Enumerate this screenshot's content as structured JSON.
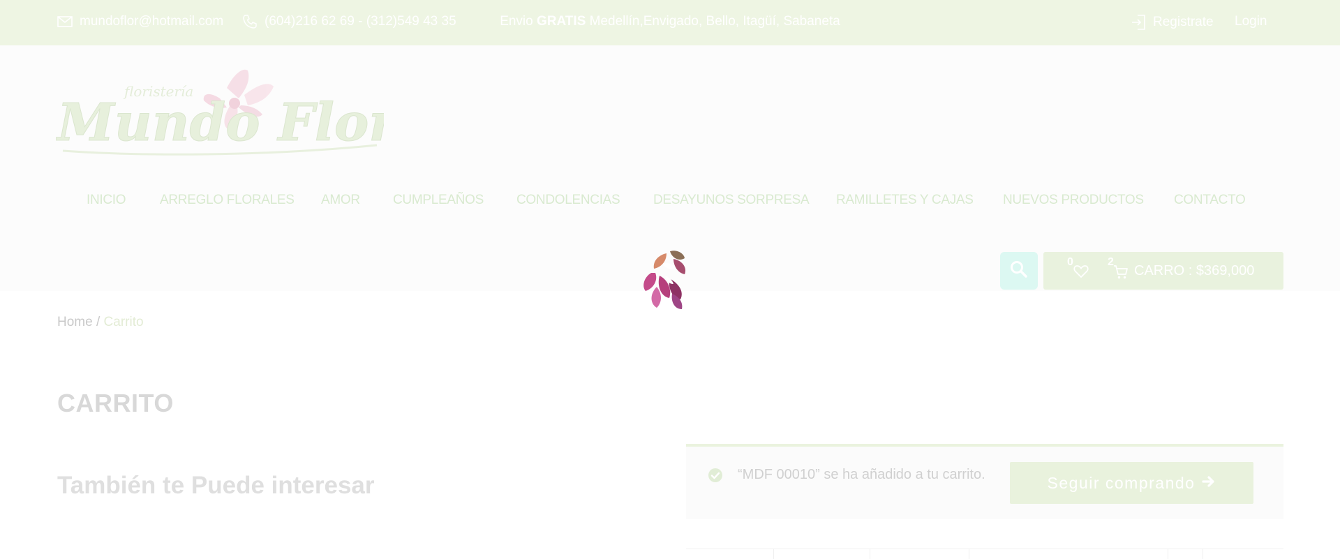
{
  "topbar": {
    "email": "mundoflor@hotmail.com",
    "phone": "(604)216 62 69 - (312)549 43 35",
    "promo_prefix": "Envio",
    "promo_bold": "GRATIS",
    "promo_suffix": "Medellín,Envigado, Bello, Itagüí, Sabaneta",
    "register_label": "Registrate",
    "login_label": "Login"
  },
  "logo": {
    "brand_top": "floristería",
    "brand_main": "Mundo Flor"
  },
  "nav": {
    "items": [
      "INICIO",
      "ARREGLO FLORALES",
      "AMOR",
      "CUMPLEAÑOS",
      "CONDOLENCIAS",
      "DESAYUNOS SORPRESA",
      "RAMILLETES Y CAJAS",
      "NUEVOS PRODUCTOS",
      "CONTACTO"
    ]
  },
  "header_actions": {
    "wishlist_count": "0",
    "cart_count": "2",
    "cart_label": "CARRO : $369,000"
  },
  "breadcrumb": {
    "home": "Home",
    "separator": " / ",
    "current": "Carrito"
  },
  "page": {
    "title": "CARRITO",
    "subtitle": "También te Puede interesar"
  },
  "notice": {
    "message": "“MDF 00010” se ha añadido a tu carrito.",
    "button_label": "Seguir comprando"
  },
  "colors": {
    "topbar_bg": "#eef5e3",
    "accent_light_green": "#e9f2dd",
    "search_bg": "#dcf8f2",
    "text_faded": "#d9ead0"
  }
}
